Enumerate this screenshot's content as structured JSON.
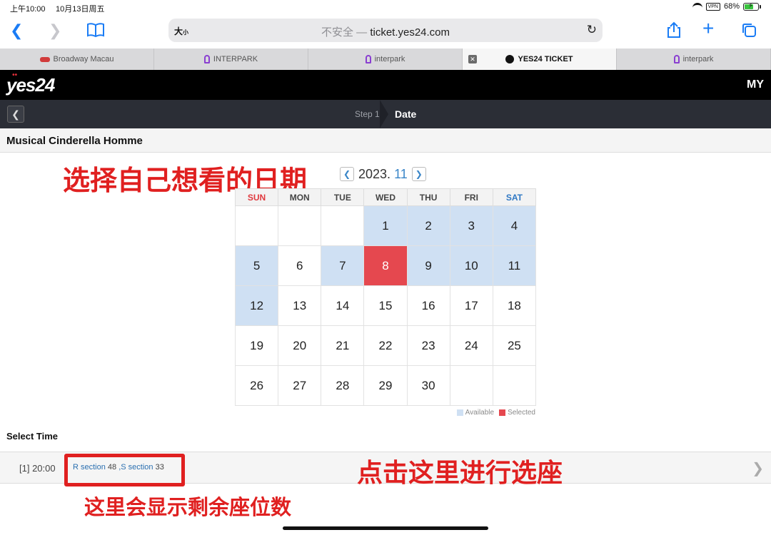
{
  "status": {
    "time": "上午10:00",
    "date": "10月13日周五",
    "vpn": "VPN",
    "battery": "68%",
    "battery_level": 0.68
  },
  "browser": {
    "aa": "大",
    "aa_small": "小",
    "url_insecure": "不安全 —",
    "url": "ticket.yes24.com",
    "icons": [
      "back-icon",
      "forward-icon",
      "bookmarks-icon",
      "reload-icon",
      "share-icon",
      "new-tab-icon",
      "tabs-icon"
    ]
  },
  "tabs": [
    {
      "label": "Broadway Macau",
      "icon": "red"
    },
    {
      "label": "INTERPARK",
      "icon": "purple"
    },
    {
      "label": "interpark",
      "icon": "purple"
    },
    {
      "label": "YES24 TICKET",
      "icon": "y"
    },
    {
      "label": "interpark",
      "icon": "purple"
    }
  ],
  "site": {
    "logo": "yes24",
    "my": "MY"
  },
  "steps": {
    "step1": "Step 1",
    "step2": "Date"
  },
  "show_title": "Musical Cinderella Homme",
  "annotations": {
    "choose_date": "选择自己想看的日期",
    "click_here": "点击这里进行选座",
    "remaining_seats": "这里会显示剩余座位数"
  },
  "calendar": {
    "year_label": "2023.",
    "month_label": "11",
    "weekdays": [
      "SUN",
      "MON",
      "TUE",
      "WED",
      "THU",
      "FRI",
      "SAT"
    ],
    "weeks": [
      [
        {
          "d": ""
        },
        {
          "d": ""
        },
        {
          "d": ""
        },
        {
          "d": "1",
          "s": "avail"
        },
        {
          "d": "2",
          "s": "avail"
        },
        {
          "d": "3",
          "s": "avail"
        },
        {
          "d": "4",
          "s": "avail"
        }
      ],
      [
        {
          "d": "5",
          "s": "avail"
        },
        {
          "d": "6"
        },
        {
          "d": "7",
          "s": "avail"
        },
        {
          "d": "8",
          "s": "selected"
        },
        {
          "d": "9",
          "s": "avail"
        },
        {
          "d": "10",
          "s": "avail"
        },
        {
          "d": "11",
          "s": "avail"
        }
      ],
      [
        {
          "d": "12",
          "s": "avail"
        },
        {
          "d": "13"
        },
        {
          "d": "14"
        },
        {
          "d": "15"
        },
        {
          "d": "16"
        },
        {
          "d": "17"
        },
        {
          "d": "18"
        }
      ],
      [
        {
          "d": "19"
        },
        {
          "d": "20"
        },
        {
          "d": "21"
        },
        {
          "d": "22"
        },
        {
          "d": "23"
        },
        {
          "d": "24"
        },
        {
          "d": "25"
        }
      ],
      [
        {
          "d": "26"
        },
        {
          "d": "27"
        },
        {
          "d": "28"
        },
        {
          "d": "29"
        },
        {
          "d": "30"
        },
        {
          "d": ""
        },
        {
          "d": ""
        }
      ]
    ],
    "legend_available": "Available",
    "legend_selected": "Selected"
  },
  "select_time": {
    "label": "Select Time",
    "slot_time": "[1] 20:00",
    "r_label": "R section",
    "r_count": "48",
    "s_label": ",S section",
    "s_count": "33"
  },
  "colors": {
    "available": "#cfe0f3",
    "selected": "#e5484f",
    "annotation": "#e02020",
    "link": "#2a6fb0"
  }
}
